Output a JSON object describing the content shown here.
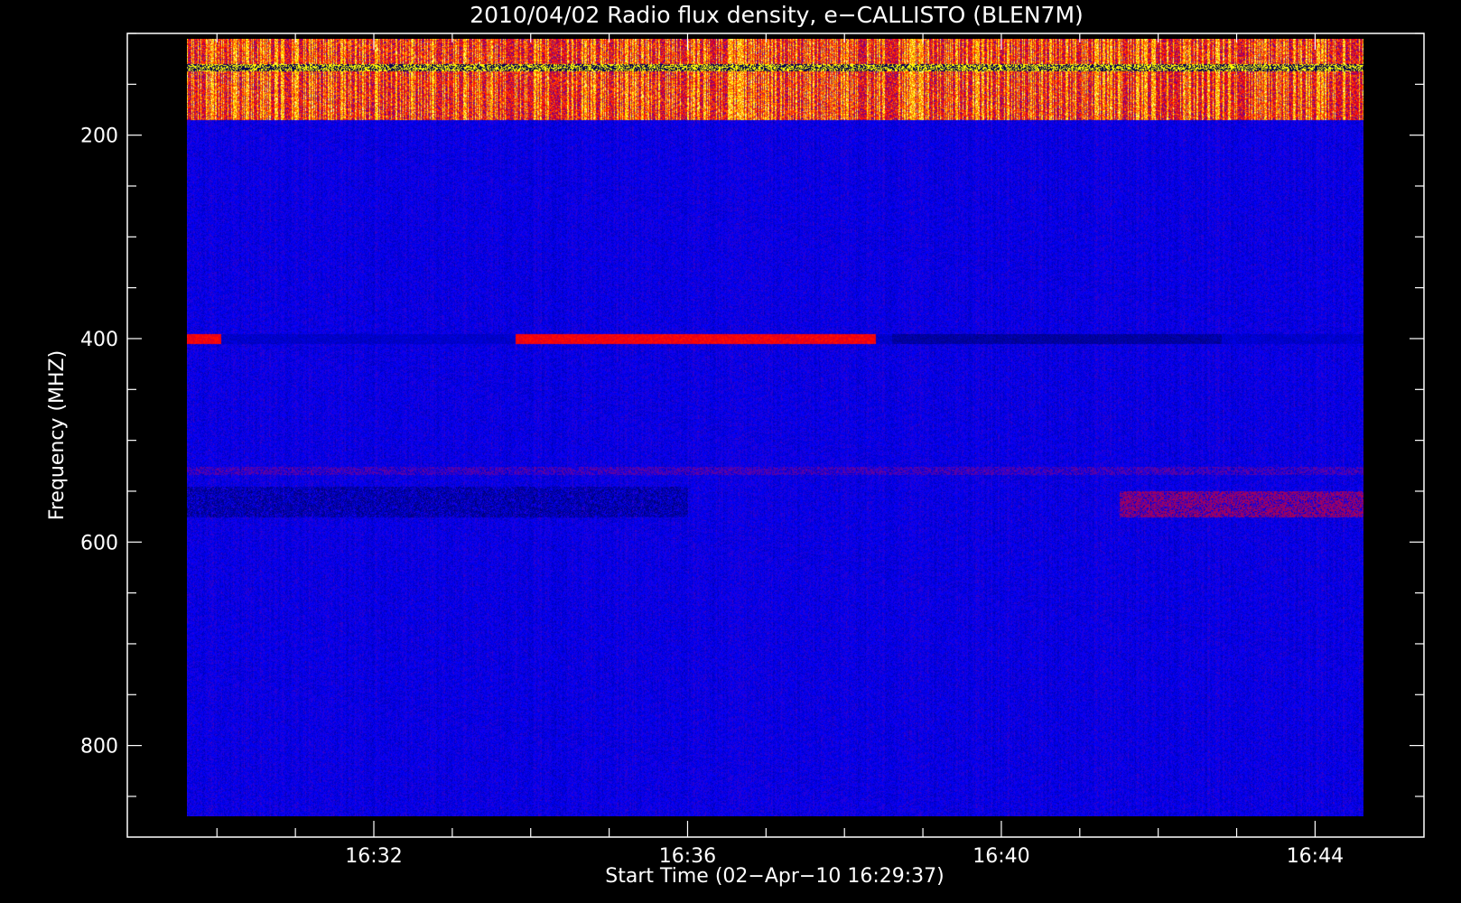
{
  "chart_data": {
    "type": "heatmap",
    "title": "2010/04/02  Radio flux density, e−CALLISTO (BLEN7M)",
    "xlabel": "Start Time (02−Apr−10 16:29:37)",
    "ylabel": "Frequency (MHZ)",
    "x_range": [
      "16:29:37",
      "16:44:37"
    ],
    "xlim_minutes": [
      16.0,
      16.767
    ],
    "x_ticks": [
      {
        "label": "16:32",
        "value": 32
      },
      {
        "label": "16:36",
        "value": 36
      },
      {
        "label": "16:40",
        "value": 40
      },
      {
        "label": "16:44",
        "value": 44
      }
    ],
    "ylim": [
      890,
      100
    ],
    "y_ticks": [
      {
        "label": "200",
        "value": 200
      },
      {
        "label": "400",
        "value": 400
      },
      {
        "label": "600",
        "value": 600
      },
      {
        "label": "800",
        "value": 800
      }
    ],
    "freq_range_mhz": [
      105,
      870
    ],
    "time_range_min": [
      29.617,
      44.617
    ],
    "colormap": [
      "#000000",
      "#0000ff",
      "#ff0000",
      "#ffff00",
      "#ffffff"
    ],
    "features": [
      {
        "name": "strong interference band",
        "freq_mhz": [
          105,
          185
        ],
        "intensity": "very high"
      },
      {
        "name": "400 MHz band",
        "freq_mhz": 400,
        "segments": [
          {
            "time_min": [
              29.617,
              30.05
            ],
            "intensity": "high"
          },
          {
            "time_min": [
              33.8,
              38.4
            ],
            "intensity": "high"
          },
          {
            "time_min": [
              38.6,
              42.8
            ],
            "intensity": "low"
          }
        ]
      },
      {
        "name": "dark band",
        "freq_mhz": [
          545,
          575
        ],
        "time_min": [
          29.617,
          36.0
        ],
        "intensity": "low"
      },
      {
        "name": "red band",
        "freq_mhz": [
          550,
          575
        ],
        "time_min": [
          41.5,
          44.617
        ],
        "intensity": "elevated"
      }
    ]
  }
}
